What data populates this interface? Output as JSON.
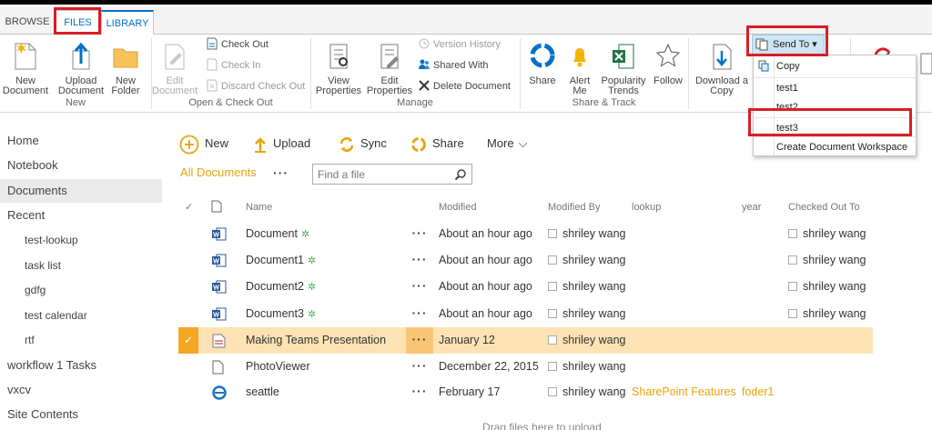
{
  "tabs": {
    "browse": "BROWSE",
    "files": "FILES",
    "library": "LIBRARY"
  },
  "ribbon": {
    "new_group": {
      "label": "New",
      "new_document": "New Document",
      "upload_document": "Upload Document",
      "new_folder": "New Folder"
    },
    "open_group": {
      "label": "Open & Check Out",
      "edit_document": "Edit Document",
      "check_out": "Check Out",
      "check_in": "Check In",
      "discard": "Discard Check Out"
    },
    "manage_group": {
      "label": "Manage",
      "view_properties": "View Properties",
      "edit_properties": "Edit Properties",
      "version_history": "Version History",
      "shared_with": "Shared With",
      "delete_document": "Delete Document"
    },
    "share_group": {
      "label": "Share & Track",
      "share": "Share",
      "alert_me": "Alert Me",
      "popularity": "Popularity Trends",
      "follow": "Follow"
    },
    "copies_group": {
      "download_copy": "Download a Copy",
      "send_to": "Send To"
    }
  },
  "send_to_menu": [
    "Copy",
    "test1",
    "test2",
    "test3",
    "Create Document Workspace"
  ],
  "nav": {
    "items": [
      "Home",
      "Notebook",
      "Documents",
      "Recent"
    ],
    "recent": [
      "test-lookup",
      "task list",
      "gdfg",
      "test calendar",
      "rtf"
    ],
    "bottom": [
      "workflow 1 Tasks",
      "vxcv",
      "Site Contents"
    ]
  },
  "commands": {
    "new": "New",
    "upload": "Upload",
    "sync": "Sync",
    "share": "Share",
    "more": "More"
  },
  "view": {
    "name": "All Documents",
    "search_placeholder": "Find a file"
  },
  "columns": {
    "name": "Name",
    "modified": "Modified",
    "modified_by": "Modified By",
    "lookup": "lookup",
    "year": "year",
    "checked_out_to": "Checked Out To"
  },
  "rows": [
    {
      "name": "Document",
      "is_new": true,
      "modified": "About an hour ago",
      "modified_by": "shriley wang",
      "lookup": "",
      "year": "",
      "checked_out_to": "shriley wang",
      "type": "word"
    },
    {
      "name": "Document1",
      "is_new": true,
      "modified": "About an hour ago",
      "modified_by": "shriley wang",
      "lookup": "",
      "year": "",
      "checked_out_to": "shriley wang",
      "type": "word"
    },
    {
      "name": "Document2",
      "is_new": true,
      "modified": "About an hour ago",
      "modified_by": "shriley wang",
      "lookup": "",
      "year": "",
      "checked_out_to": "shriley wang",
      "type": "word"
    },
    {
      "name": "Document3",
      "is_new": true,
      "modified": "About an hour ago",
      "modified_by": "shriley wang",
      "lookup": "",
      "year": "",
      "checked_out_to": "shriley wang",
      "type": "word"
    },
    {
      "name": "Making Teams Presentation",
      "is_new": false,
      "modified": "January 12",
      "modified_by": "shriley wang",
      "lookup": "",
      "year": "",
      "checked_out_to": "",
      "type": "pdf",
      "selected": true
    },
    {
      "name": "PhotoViewer",
      "is_new": false,
      "modified": "December 22, 2015",
      "modified_by": "shriley wang",
      "lookup": "",
      "year": "",
      "checked_out_to": "",
      "type": "file"
    },
    {
      "name": "seattle",
      "is_new": false,
      "modified": "February 17",
      "modified_by": "shriley wang",
      "lookup": "SharePoint Features",
      "year": "foder1",
      "checked_out_to": "",
      "type": "ie"
    }
  ],
  "new_mark": "✲",
  "drag_hint": "Drag files here to upload",
  "colors": {
    "accent": "#0072c6",
    "link": "#e8a30b",
    "selected_row": "#fde3b4",
    "highlight_box": "#d81e25"
  }
}
